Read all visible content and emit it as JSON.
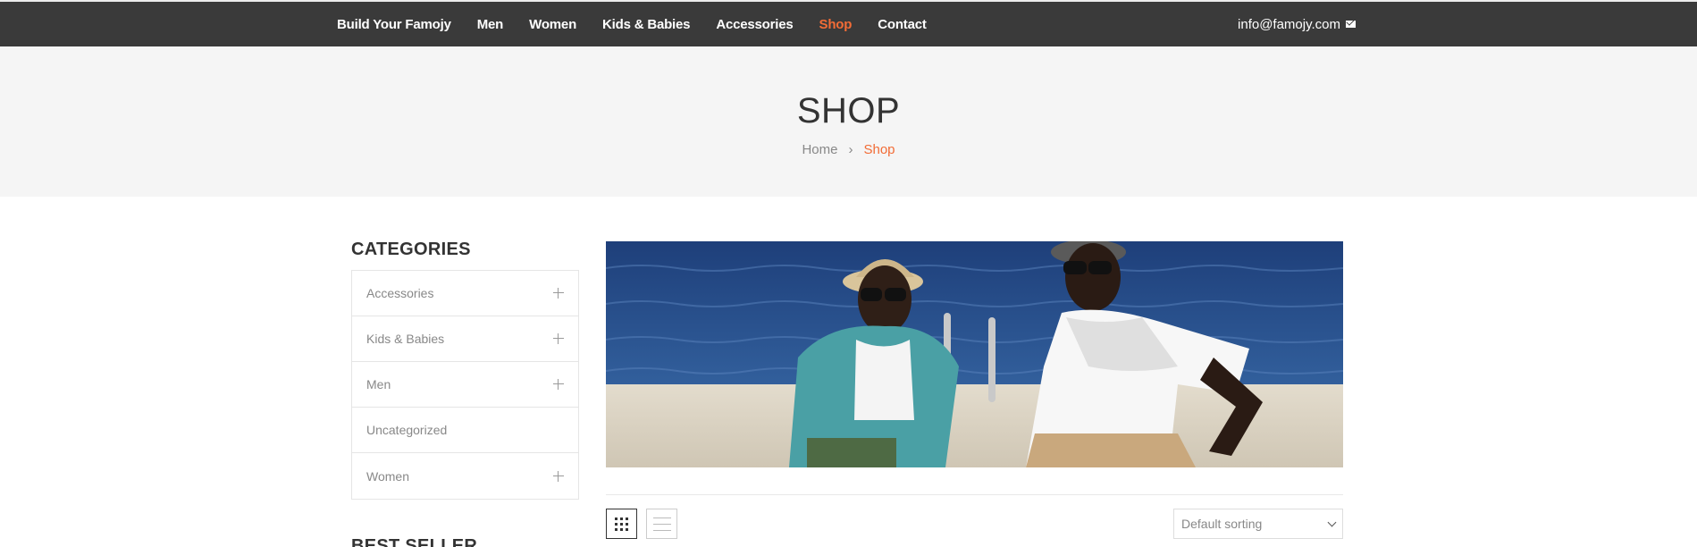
{
  "nav": {
    "items": [
      {
        "label": "Build Your Famojy",
        "active": false
      },
      {
        "label": "Men",
        "active": false
      },
      {
        "label": "Women",
        "active": false
      },
      {
        "label": "Kids & Babies",
        "active": false
      },
      {
        "label": "Accessories",
        "active": false
      },
      {
        "label": "Shop",
        "active": true
      },
      {
        "label": "Contact",
        "active": false
      }
    ],
    "email": "info@famojy.com",
    "email_icon": "envelope-icon"
  },
  "hero": {
    "title": "SHOP",
    "breadcrumb": {
      "home": "Home",
      "separator": "›",
      "current": "Shop"
    }
  },
  "sidebar": {
    "categories_title": "CATEGORIES",
    "categories": [
      {
        "label": "Accessories",
        "expandable": true
      },
      {
        "label": "Kids & Babies",
        "expandable": true
      },
      {
        "label": "Men",
        "expandable": true
      },
      {
        "label": "Uncategorized",
        "expandable": false
      },
      {
        "label": "Women",
        "expandable": true
      }
    ],
    "best_seller_title": "BEST SELLER"
  },
  "toolbar": {
    "sort_selected": "Default sorting",
    "view_modes": [
      "grid-view-icon",
      "list-view-icon"
    ],
    "active_view": "grid"
  },
  "colors": {
    "topbar": "#3a3a3a",
    "accent": "#f26c36",
    "hero_bg": "#f5f5f5"
  }
}
